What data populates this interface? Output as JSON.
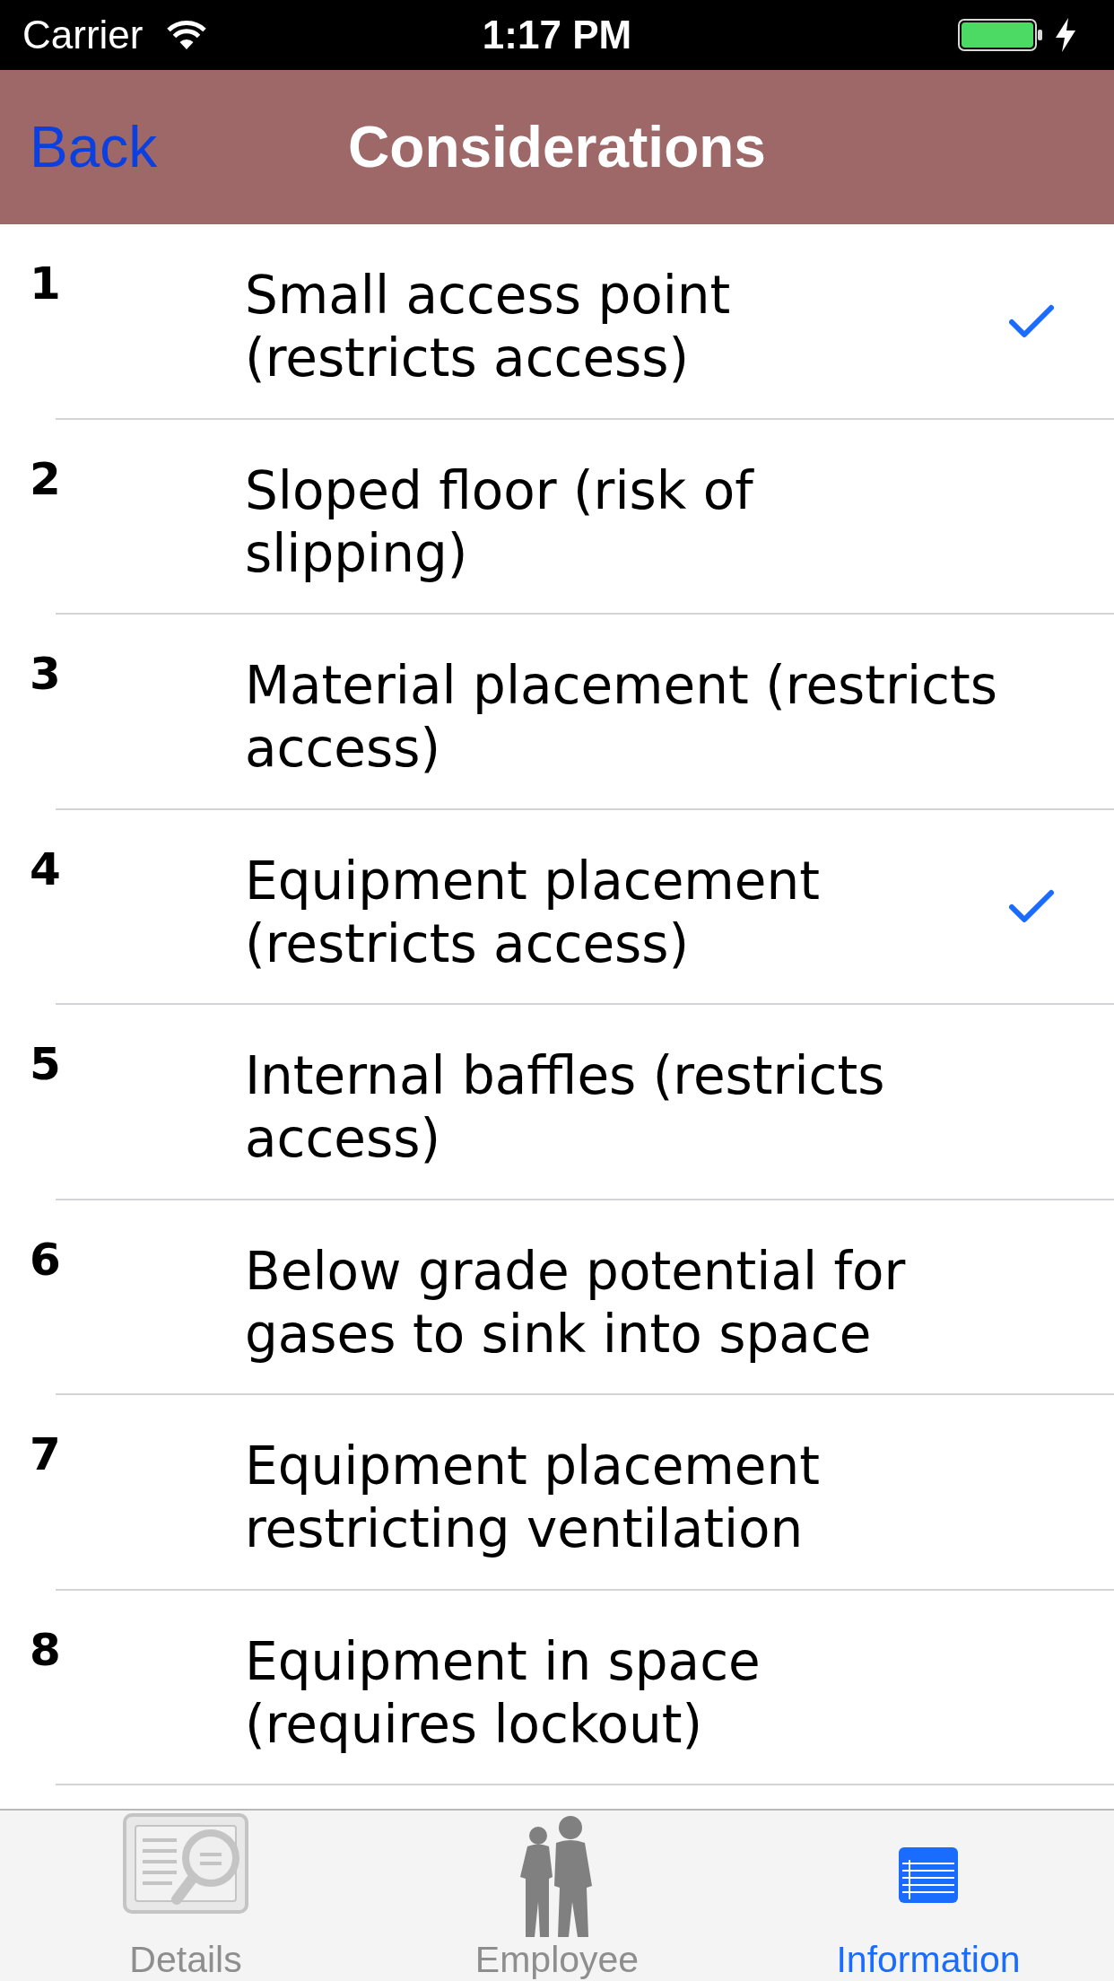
{
  "status_bar": {
    "carrier": "Carrier",
    "time": "1:17 PM"
  },
  "nav_bar": {
    "back": "Back",
    "title": "Considerations"
  },
  "rows": [
    {
      "number": "1",
      "text": "Small access point\n(restricts access)",
      "checked": true
    },
    {
      "number": "2",
      "text": "Sloped floor (risk of\nslipping)",
      "checked": false
    },
    {
      "number": "3",
      "text": "Material placement (restricts\naccess)",
      "checked": false
    },
    {
      "number": "4",
      "text": "Equipment placement\n(restricts access)",
      "checked": true
    },
    {
      "number": "5",
      "text": "Internal baffles (restricts\naccess)",
      "checked": false
    },
    {
      "number": "6",
      "text": "Below grade potential for\ngases to sink into space",
      "checked": false
    },
    {
      "number": "7",
      "text": "Equipment placement\nrestricting ventilation",
      "checked": false
    },
    {
      "number": "8",
      "text": "Equipment in space\n(requires lockout)",
      "checked": false
    }
  ],
  "tab_bar": [
    {
      "kind": "details",
      "label": "Details",
      "selected": false
    },
    {
      "kind": "employee",
      "label": "Employee",
      "selected": false
    },
    {
      "kind": "information",
      "label": "Information",
      "selected": true
    }
  ]
}
